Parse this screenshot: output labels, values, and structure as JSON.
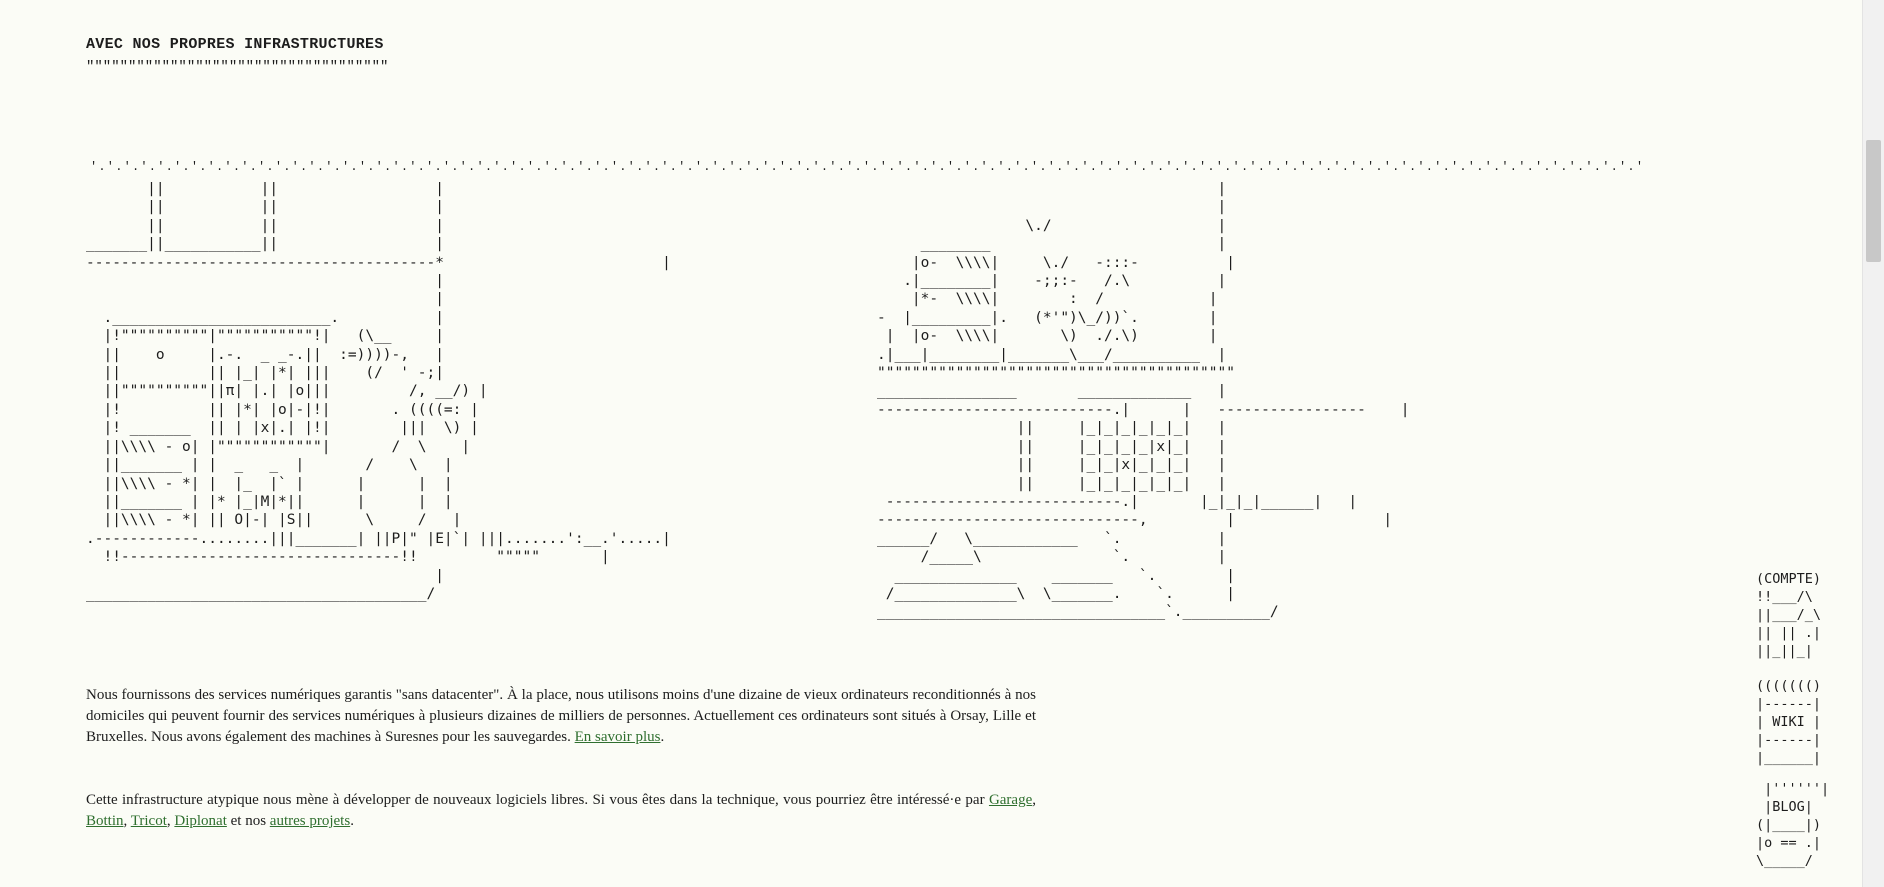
{
  "section": {
    "heading": "AVEC NOS PROPRES INFRASTRUCTURES",
    "underline": "\"\"\"\"\"\"\"\"\"\"\"\"\"\"\"\"\"\"\"\"\"\"\"\"\"\"\"\"\"\"\"\"\"\"\"\""
  },
  "art": {
    "dots": "'.'.'.'.'.'.'.'.'.'.'.'.'.'.'.'.'.'.'.'.'.'.'.'.'.'.'.'.'.'.'.'.'.'.'.'.'.'.'.'.'.'.'.'.'.'.'.'.'.'.'.'.'.'.'.'.'.'.'.'.'.'.'.'.'.'.'.'.'.'.'.'.'.'.'.'.'.'.'.'.'.'.'.'.'.'.'.'.'.'.'.'.'",
    "left": "       ||           ||                  |\n       ||           ||                  |\n       ||           ||                  |\n_______||___________||                  |\n----------------------------------------*                         |\n                                        |\n                                        |\n  ._________________________.           |\n  |!\"\"\"\"\"\"\"\"\"\"|\"\"\"\"\"\"\"\"\"\"\"!|   (\\__     |\n  ||    o     |.-.  _ _-.||  :=))))-,   |\n  ||          || |_| |*| |||    (/  ' -;|\n  ||\"\"\"\"\"\"\"\"\"\"||π| |.| |o|||         /, __/) |\n  |!          || |*| |o|-|!|       . ((((=: |\n  |! _______  || | |x|.| |!|        |||  \\) |\n  ||\\\\\\\\ - o| |\"\"\"\"\"\"\"\"\"\"\"\"|       /  \\    |\n  ||_______ | |  _   _  |       /    \\   |\n  ||\\\\\\\\ - *| |  |_  |` |      |      |  |\n  ||_______ | |* |_|M|*||      |      |  |\n  ||\\\\\\\\ - *| || O|-| |S||      \\     /   |\n.------------........|||_______| ||P|\" |E|`| |||.......':__.'.....|\n  !!--------------------------------!!         \"\"\"\"\"       |\n                                        |\n_______________________________________/",
    "right": "                                       |\n                                       |\n                 \\./                   |\n     ________                          |\n    |o-  \\\\\\\\|     \\./   -:::-          |\n   .|________|    -;;:-   /.\\          |\n    |*-  \\\\\\\\|        :  /            |\n-  |_________|.   (*'\")\\_/))`.        |\n |  |o-  \\\\\\\\|       \\)  ./.\\)        |\n.|___|________|_______\\___/__________  |\n\"\"\"\"\"\"\"\"\"\"\"\"\"\"\"\"\"\"\"\"\"\"\"\"\"\"\"\"\"\"\"\"\"\"\"\"\"\"\"\"\"\n________________       _____________   |\n---------------------------.|      |   -----------------    |\n                ||     |_|_|_|_|_|_|   |\n                ||     |_|_|_|_|x|_|   |\n                ||     |_|_|x|_|_|_|   |\n                ||     |_|_|_|_|_|_|   |\n ---------------------------.|       |_|_|_|______|   |\n------------------------------,         |                 |\n______/   \\____________   `.           |\n     /_____\\               `.          |\n  ______________    _______   `.        |\n /______________\\  \\_______.    `.      |\n_________________________________`.__________/"
  },
  "sidebar": {
    "compte": "(COMPTE)\n!!___/\\\n||___/_\\\n|| || .|\n||_||_|",
    "wiki": "((((((()\n|------|\n| WIKI |\n|------|\n|______|",
    "blog": " |''''''|\n |BLOG|\n(|____|)\n|o == .|\n\\_____/"
  },
  "paragraph1": {
    "text": "Nous fournissons des services numériques garantis \"sans datacenter\". À la place, nous utilisons moins d'une dizaine de vieux ordinateurs reconditionnés à nos domiciles qui peuvent fournir des services numériques à plusieurs dizaines de milliers de personnes. Actuellement ces ordinateurs sont situés à Orsay, Lille et Bruxelles. Nous avons également des machines à Suresnes pour les sauvegardes. ",
    "link": "En savoir plus",
    "end": "."
  },
  "paragraph2": {
    "text": "Cette infrastructure atypique nous mène à développer de nouveaux logiciels libres. Si vous êtes dans la technique, vous pourriez être intéressé·e par ",
    "links": [
      "Garage",
      "Bottin",
      "Tricot",
      "Diplonat"
    ],
    "sep": ", ",
    "and": " et nos ",
    "projects_link": "autres projets",
    "end": "."
  }
}
